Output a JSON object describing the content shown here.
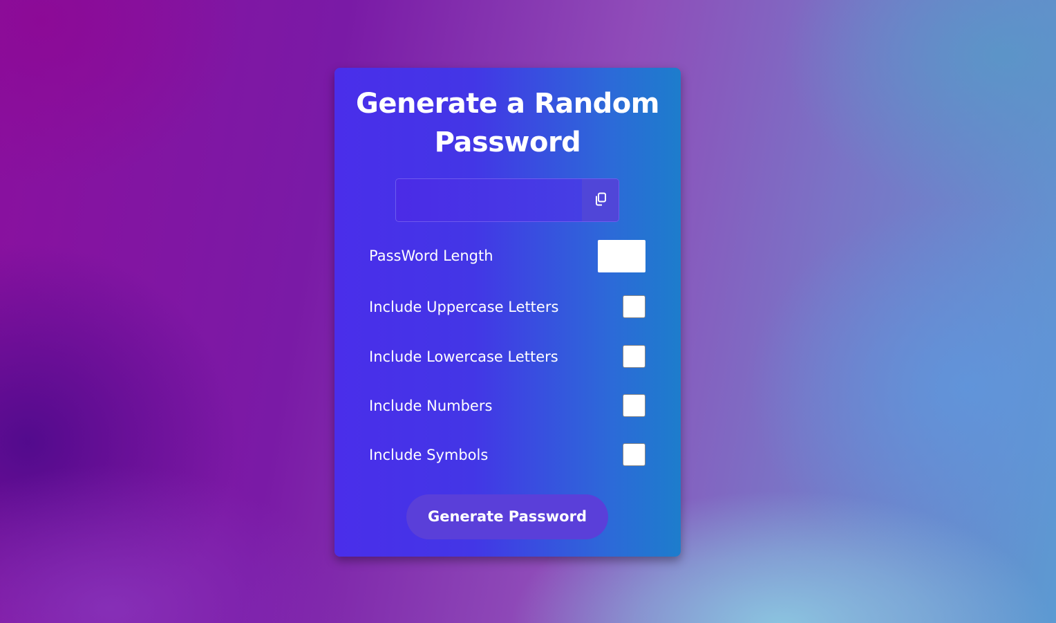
{
  "card": {
    "title_line1": "Generate a Random",
    "title_line2": "Password"
  },
  "result": {
    "value": "",
    "copy_icon": "copy-icon"
  },
  "settings": {
    "length_label": "PassWord Length",
    "length_value": "",
    "uppercase_label": "Include Uppercase Letters",
    "lowercase_label": "Include Lowercase Letters",
    "numbers_label": "Include Numbers",
    "symbols_label": "Include Symbols"
  },
  "actions": {
    "generate_label": "Generate Password"
  },
  "colors": {
    "card_gradient_start": "#4a2eea",
    "card_gradient_end": "#1d7dcc",
    "button": "#5a3fd9",
    "text": "#ffffff"
  }
}
